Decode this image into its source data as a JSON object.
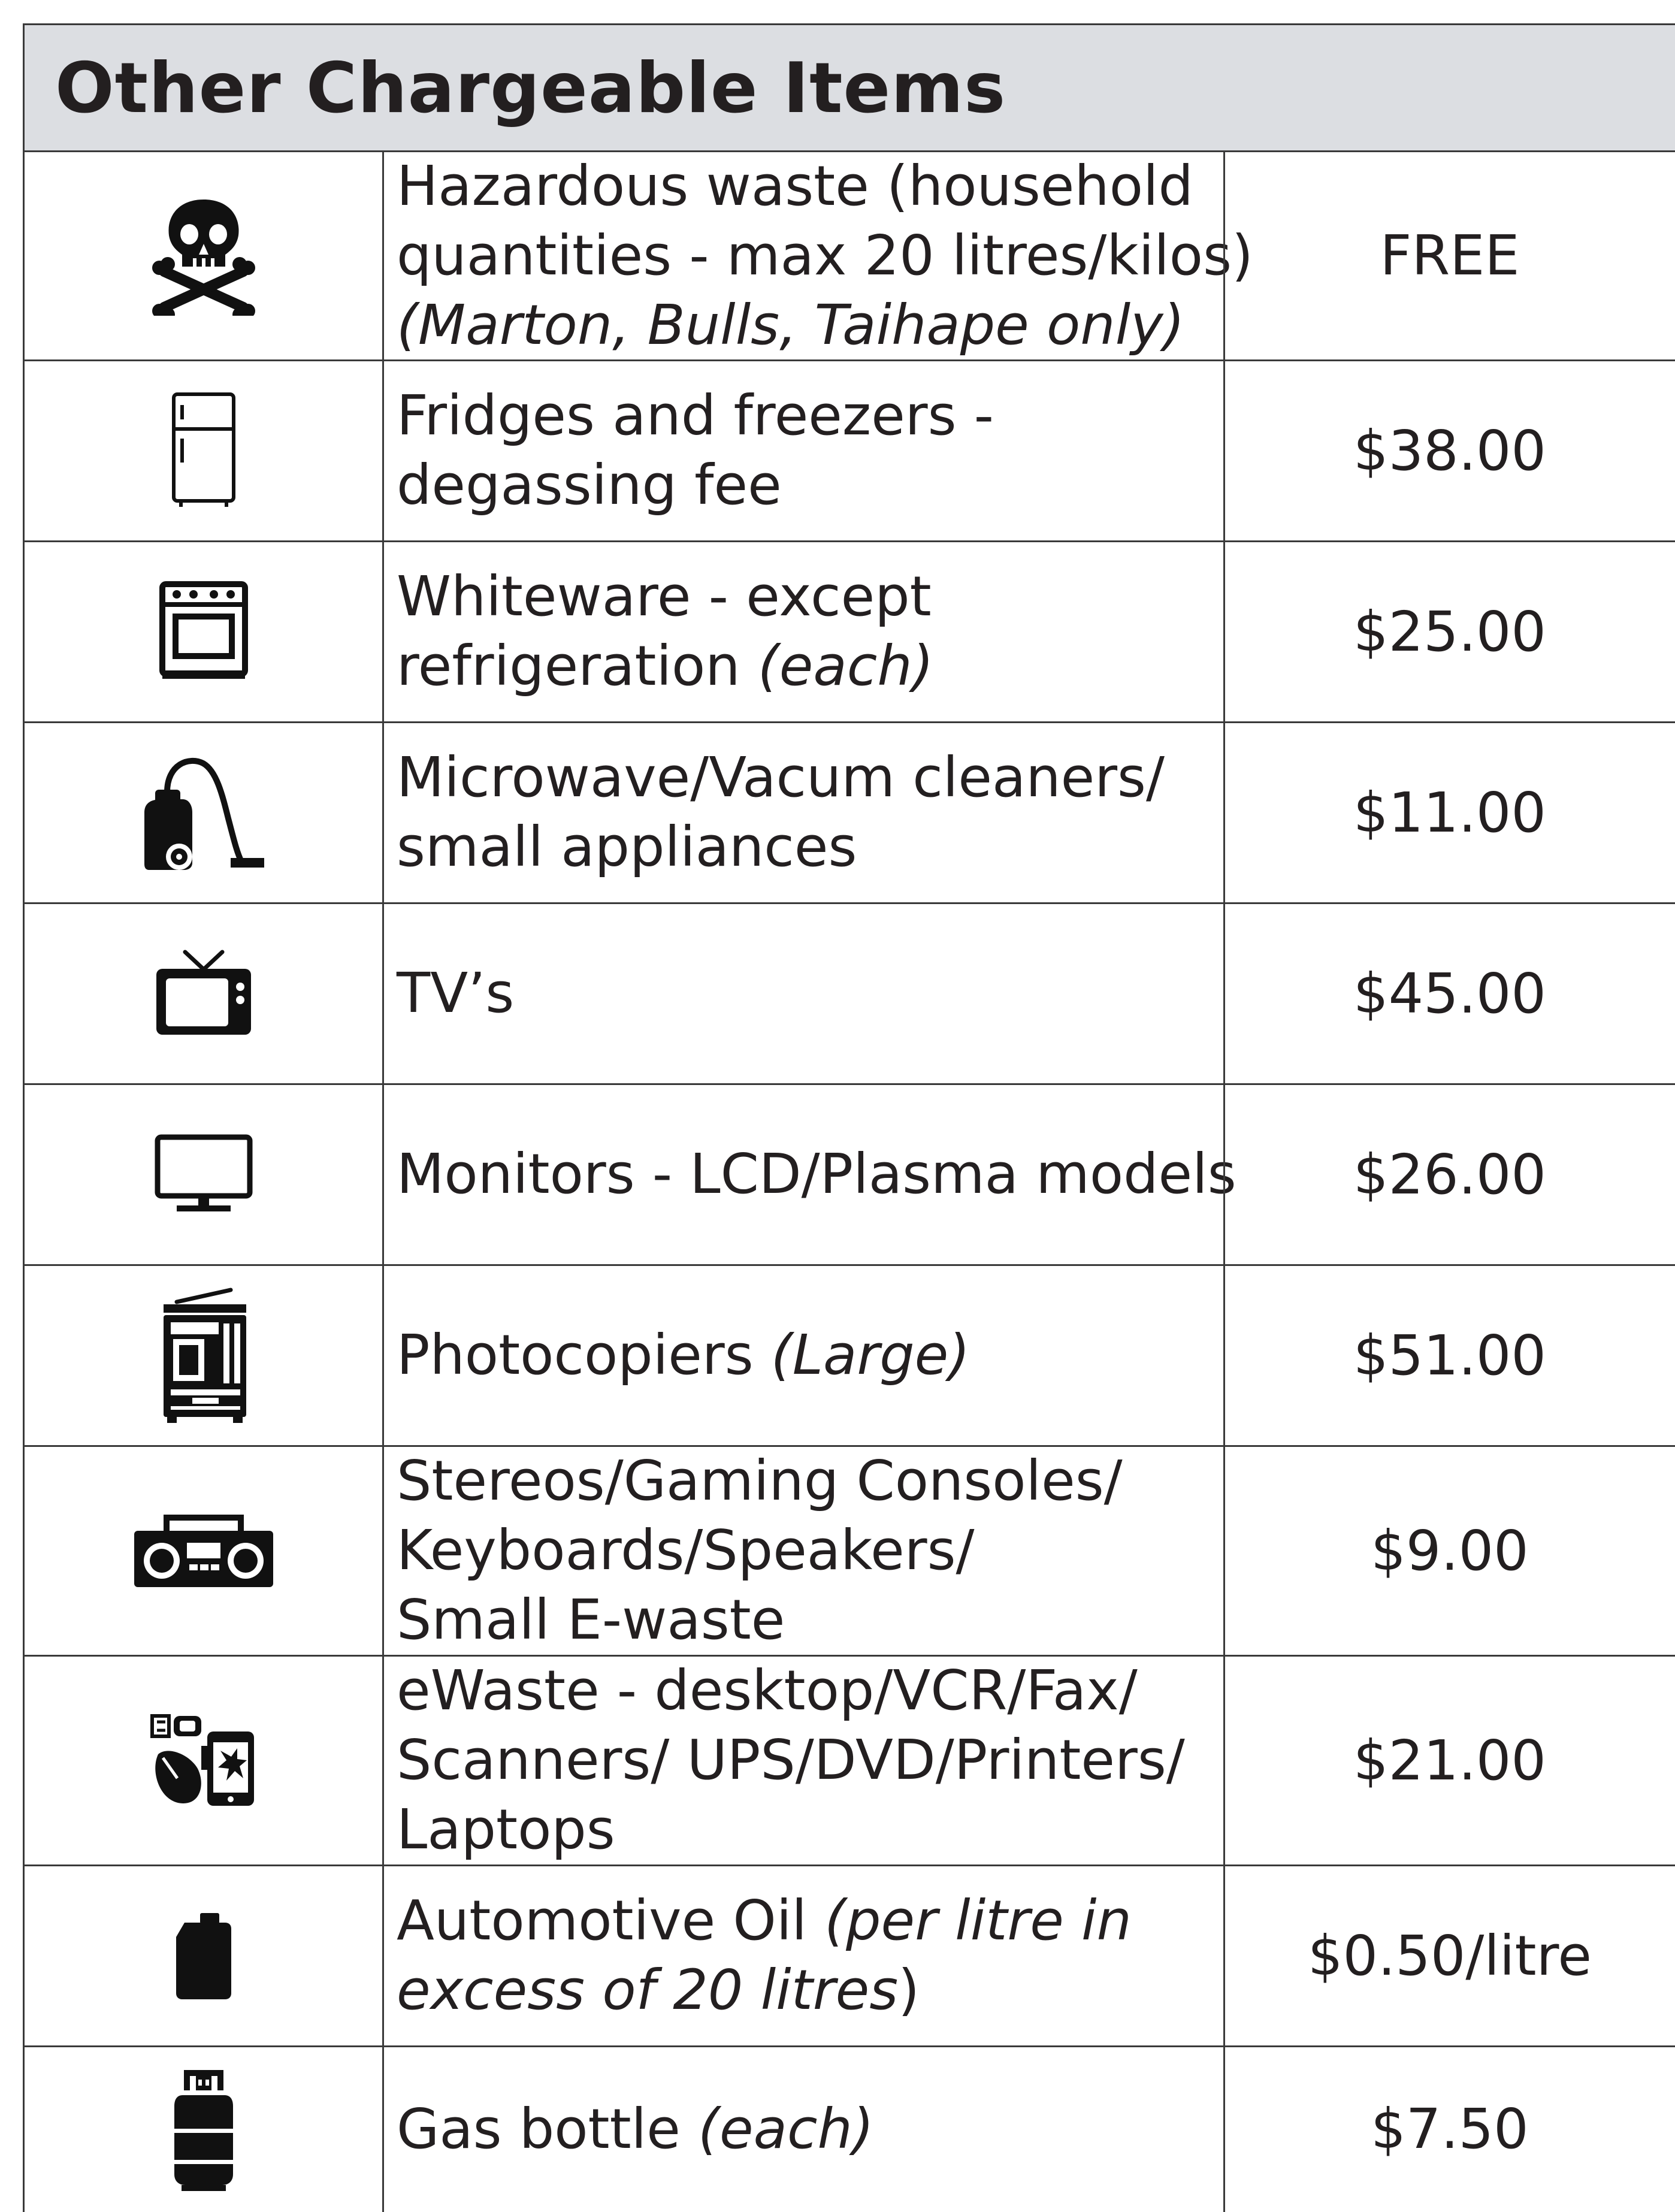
{
  "title": "Other Chargeable Items",
  "rows": [
    {
      "icon": "skull-crossbones-icon",
      "lines": [
        [
          {
            "t": "Hazardous waste (household"
          }
        ],
        [
          {
            "t": "quantities - max 20 litres/kilos)"
          }
        ],
        [
          {
            "t": "(Marton, Bulls, Taihape only)",
            "i": true
          }
        ]
      ],
      "price": "FREE"
    },
    {
      "icon": "fridge-icon",
      "lines": [
        [
          {
            "t": "Fridges and freezers -"
          }
        ],
        [
          {
            "t": "degassing fee"
          }
        ]
      ],
      "price": "$38.00"
    },
    {
      "icon": "oven-icon",
      "lines": [
        [
          {
            "t": "Whiteware - except"
          }
        ],
        [
          {
            "t": "refrigeration "
          },
          {
            "t": "(each)",
            "i": true
          }
        ]
      ],
      "price": "$25.00"
    },
    {
      "icon": "vacuum-cleaner-icon",
      "lines": [
        [
          {
            "t": "Microwave/Vacum cleaners/"
          }
        ],
        [
          {
            "t": "small appliances"
          }
        ]
      ],
      "price": "$11.00"
    },
    {
      "icon": "tv-icon",
      "lines": [
        [
          {
            "t": "TV’s"
          }
        ]
      ],
      "price": "$45.00"
    },
    {
      "icon": "monitor-icon",
      "lines": [
        [
          {
            "t": "Monitors - LCD/Plasma models"
          }
        ]
      ],
      "price": "$26.00"
    },
    {
      "icon": "photocopier-icon",
      "lines": [
        [
          {
            "t": "Photocopiers "
          },
          {
            "t": "(Large)",
            "i": true
          }
        ]
      ],
      "price": "$51.00"
    },
    {
      "icon": "boombox-icon",
      "lines": [
        [
          {
            "t": "Stereos/Gaming Consoles/"
          }
        ],
        [
          {
            "t": "Keyboards/Speakers/"
          }
        ],
        [
          {
            "t": "Small E-waste"
          }
        ]
      ],
      "price": "$9.00"
    },
    {
      "icon": "ewaste-devices-icon",
      "lines": [
        [
          {
            "t": "eWaste - desktop/VCR/Fax/"
          }
        ],
        [
          {
            "t": "Scanners/ UPS/DVD/Printers/"
          }
        ],
        [
          {
            "t": "Laptops"
          }
        ]
      ],
      "price": "$21.00"
    },
    {
      "icon": "oil-can-icon",
      "lines": [
        [
          {
            "t": "Automotive Oil "
          },
          {
            "t": "(per litre in",
            "i": true
          }
        ],
        [
          {
            "t": "excess of 20 litres",
            "i": true
          },
          {
            "t": ")"
          }
        ]
      ],
      "price": "$0.50/litre"
    },
    {
      "icon": "gas-bottle-icon",
      "lines": [
        [
          {
            "t": "Gas bottle "
          },
          {
            "t": "(each)",
            "i": true
          }
        ]
      ],
      "price": "$7.50"
    }
  ]
}
